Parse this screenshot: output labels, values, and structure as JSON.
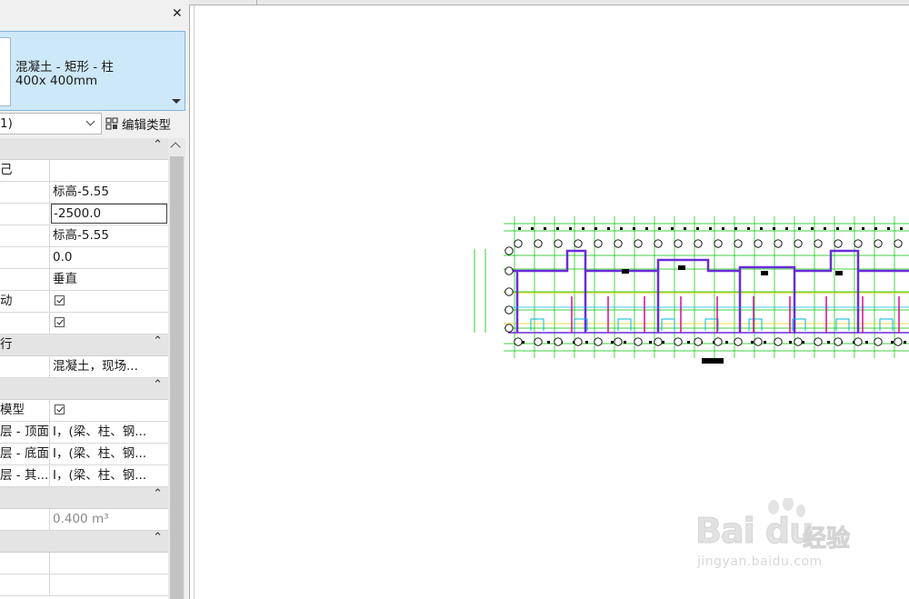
{
  "panel": {
    "close_label": "✕",
    "type": {
      "name": "混凝土 - 矩形 - 柱",
      "size": "400x 400mm"
    },
    "filter": {
      "selected": "1)"
    },
    "edit_type_label": "编辑类型",
    "rows": [
      {
        "kind": "group",
        "name": ""
      },
      {
        "kind": "prop",
        "name": "己",
        "value": ""
      },
      {
        "kind": "prop",
        "name": "",
        "value": "标高-5.55"
      },
      {
        "kind": "prop",
        "name": "",
        "value": "-2500.0",
        "editing": true
      },
      {
        "kind": "prop",
        "name": "",
        "value": "标高-5.55"
      },
      {
        "kind": "prop",
        "name": "",
        "value": "0.0"
      },
      {
        "kind": "prop",
        "name": "",
        "value": "垂直"
      },
      {
        "kind": "prop",
        "name": "动",
        "check": true
      },
      {
        "kind": "prop",
        "name": "",
        "check": true
      },
      {
        "kind": "group",
        "name": "行"
      },
      {
        "kind": "prop",
        "name": "",
        "value": "混凝土，现场..."
      },
      {
        "kind": "group",
        "name": ""
      },
      {
        "kind": "prop",
        "name": "模型",
        "check": true
      },
      {
        "kind": "prop",
        "name": "层 - 顶面",
        "value": "I，(梁、柱、钢..."
      },
      {
        "kind": "prop",
        "name": "层 - 底面",
        "value": "I，(梁、柱、钢..."
      },
      {
        "kind": "prop",
        "name": "层 - 其...",
        "value": "I，(梁、柱、钢..."
      },
      {
        "kind": "group",
        "name": ""
      },
      {
        "kind": "prop",
        "name": "",
        "value": "0.400 m³",
        "dim": true
      },
      {
        "kind": "group",
        "name": ""
      },
      {
        "kind": "prop",
        "name": "",
        "value": ""
      },
      {
        "kind": "prop",
        "name": "",
        "value": ""
      }
    ],
    "collapse_icon": "chevron-up-icon"
  },
  "watermark": {
    "brand": "Bai du",
    "cn": "经验",
    "url": "jingyan.baidu.com"
  },
  "colors": {
    "accent": "#cde8f8",
    "grid_lines": "#00c000",
    "walls": "#6a2cd8",
    "columns": "#d01090",
    "cyan": "#00b8d8",
    "yellow": "#e0d000"
  }
}
